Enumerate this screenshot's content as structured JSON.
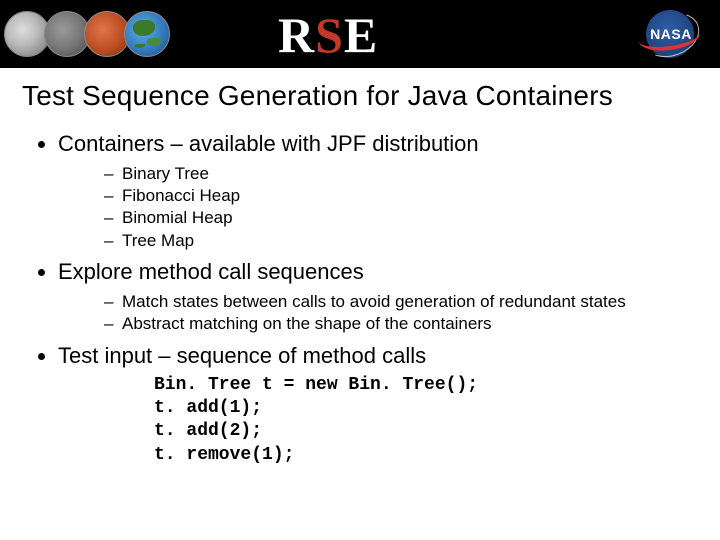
{
  "header": {
    "org_logo_text": "RSE",
    "nasa_text": "NASA"
  },
  "title": "Test Sequence Generation for Java Containers",
  "bullets": {
    "b1": "Containers – available with JPF distribution",
    "b1_subs": [
      "Binary Tree",
      "Fibonacci Heap",
      "Binomial Heap",
      "Tree Map"
    ],
    "b2": "Explore method call sequences",
    "b2_subs": [
      "Match states between calls to avoid generation of redundant states",
      "Abstract matching on the shape of the containers"
    ],
    "b3": "Test input – sequence of method calls",
    "code": "Bin. Tree t = new Bin. Tree();\nt. add(1);\nt. add(2);\nt. remove(1);"
  }
}
